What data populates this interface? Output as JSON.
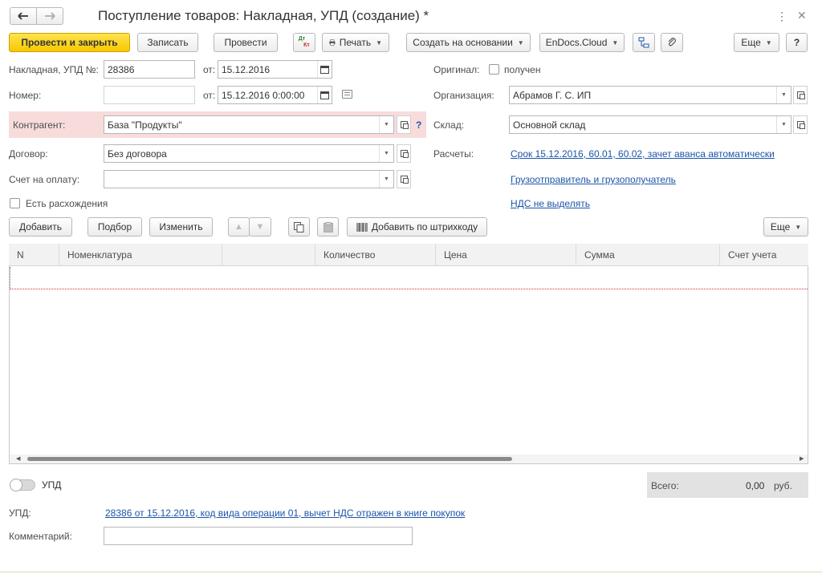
{
  "window": {
    "title": "Поступление товаров: Накладная, УПД (создание) *"
  },
  "toolbar": {
    "post_close": "Провести и закрыть",
    "save": "Записать",
    "post": "Провести",
    "dt_kt_top": "Дт",
    "dt_kt_bottom": "Кт",
    "print": "Печать",
    "create_based": "Создать на основании",
    "endocs": "EnDocs.Cloud",
    "more": "Еще",
    "help": "?"
  },
  "form": {
    "invoice_label": "Накладная, УПД №:",
    "invoice_number": "28386",
    "from_label": "от:",
    "invoice_date": "15.12.2016",
    "number_label": "Номер:",
    "number_value": "",
    "from_label2": "от:",
    "number_date": "15.12.2016  0:00:00",
    "original_label": "Оригинал:",
    "original_checkbox_label": "получен",
    "org_label": "Организация:",
    "org_value": "Абрамов Г. С. ИП",
    "counterparty_label": "Контрагент:",
    "counterparty_value": "База \"Продукты\"",
    "help_q": "?",
    "warehouse_label": "Склад:",
    "warehouse_value": "Основной склад",
    "contract_label": "Договор:",
    "contract_value": "Без договора",
    "settlements_label": "Расчеты:",
    "settlements_link": "Срок 15.12.2016, 60.01, 60.02, зачет аванса автоматически",
    "payment_invoice_label": "Счет на оплату:",
    "payment_invoice_value": "",
    "shipper_link": "Грузоотправитель и грузополучатель",
    "discrepancy_label": "Есть расхождения",
    "vat_link": "НДС не выделять"
  },
  "table_toolbar": {
    "add": "Добавить",
    "pick": "Подбор",
    "change": "Изменить",
    "add_barcode": "Добавить по штрихкоду",
    "more": "Еще"
  },
  "table": {
    "columns": [
      "N",
      "Номенклатура",
      "",
      "Количество",
      "Цена",
      "Сумма",
      "Счет учета"
    ],
    "rows": []
  },
  "footer": {
    "upd_toggle_label": "УПД",
    "total_label": "Всего:",
    "total_value": "0,00",
    "currency": "руб.",
    "upd_label": "УПД:",
    "upd_link": "28386 от 15.12.2016, код вида операции 01, вычет НДС отражен в книге покупок",
    "comment_label": "Комментарий:",
    "comment_value": ""
  },
  "colors": {
    "accent_yellow": "#f7c800",
    "link_blue": "#1c55a8",
    "highlight_pink": "#f8dcdc"
  }
}
